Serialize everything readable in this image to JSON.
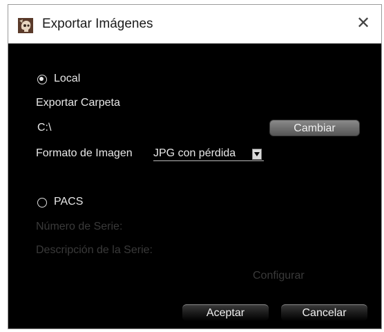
{
  "window": {
    "title": "Exportar Imágenes",
    "close_icon": "close-icon",
    "app_icon": "skull-app-icon"
  },
  "local": {
    "label": "Local",
    "selected": true,
    "export_folder_label": "Exportar Carpeta",
    "folder_path": "C:\\",
    "change_button": "Cambiar",
    "format_label": "Formato de Imagen",
    "format_value": "JPG con pérdida"
  },
  "pacs": {
    "label": "PACS",
    "selected": false,
    "series_number_label": "Número de Serie:",
    "series_description_label": "Descripción de la Serie:",
    "configure_button": "Configurar"
  },
  "footer": {
    "accept_button": "Aceptar",
    "cancel_button": "Cancelar"
  },
  "colors": {
    "dialog_background": "#000000",
    "titlebar_background": "#ffffff",
    "text": "#e8e8e8",
    "disabled_text": "#3a3a3a"
  }
}
